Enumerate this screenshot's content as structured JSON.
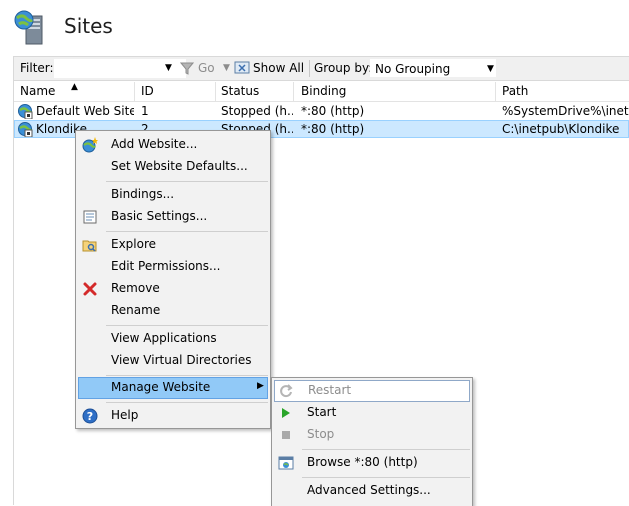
{
  "header": {
    "title": "Sites"
  },
  "filter_bar": {
    "filter_label": "Filter:",
    "filter_value": "",
    "go_label": "Go",
    "show_all_label": "Show All",
    "group_by_label": "Group by:",
    "group_by_value": "No Grouping"
  },
  "columns": [
    "Name",
    "ID",
    "Status",
    "Binding",
    "Path"
  ],
  "sites": [
    {
      "name": "Default Web Site",
      "id": "1",
      "status": "Stopped (h...",
      "binding": "*:80 (http)",
      "path": "%SystemDrive%\\inetpub"
    },
    {
      "name": "Klondike",
      "id": "2",
      "status": "Stopped (h...",
      "binding": "*:80 (http)",
      "path": "C:\\inetpub\\Klondike"
    }
  ],
  "context_menu": {
    "items": [
      "Add Website...",
      "Set Website Defaults...",
      "Bindings...",
      "Basic Settings...",
      "Explore",
      "Edit Permissions...",
      "Remove",
      "Rename",
      "View Applications",
      "View Virtual Directories",
      "Manage Website",
      "Help"
    ]
  },
  "submenu": {
    "items": [
      "Restart",
      "Start",
      "Stop",
      "Browse *:80 (http)",
      "Advanced Settings..."
    ]
  },
  "colors": {
    "selection": "#cce8ff",
    "menu_hover": "#91c9f7",
    "remove_icon": "#d42a2a",
    "start_icon": "#2aa52a"
  }
}
